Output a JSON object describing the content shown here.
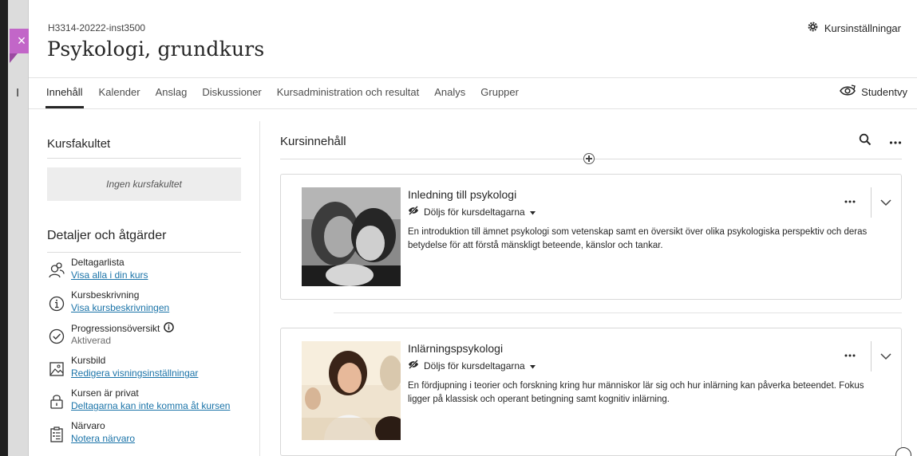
{
  "header": {
    "course_id": "H3314-20222-inst3500",
    "course_title": "Psykologi, grundkurs",
    "settings_label": "Kursinställningar",
    "close_label": "×",
    "backdrop_letter": "I"
  },
  "tabs": [
    {
      "label": "Innehåll",
      "active": true
    },
    {
      "label": "Kalender"
    },
    {
      "label": "Anslag"
    },
    {
      "label": "Diskussioner"
    },
    {
      "label": "Kursadministration och resultat"
    },
    {
      "label": "Analys"
    },
    {
      "label": "Grupper"
    }
  ],
  "studentvy_label": "Studentvy",
  "sidebar": {
    "faculty_title": "Kursfakultet",
    "no_faculty": "Ingen kursfakultet",
    "details_title": "Detaljer och åtgärder",
    "items": [
      {
        "icon": "people-icon",
        "label": "Deltagarlista",
        "link": "Visa alla i din kurs"
      },
      {
        "icon": "info-icon",
        "label": "Kursbeskrivning",
        "link": "Visa kursbeskrivningen"
      },
      {
        "icon": "check-circle-icon",
        "label": "Progressionsöversikt",
        "status": "Aktiverad"
      },
      {
        "icon": "image-icon",
        "label": "Kursbild",
        "link": "Redigera visningsinställningar"
      },
      {
        "icon": "lock-icon",
        "label": "Kursen är privat",
        "link": "Deltagarna kan inte komma åt kursen"
      },
      {
        "icon": "attendance-icon",
        "label": "Närvaro",
        "link": "Notera närvaro"
      }
    ]
  },
  "main": {
    "title": "Kursinnehåll",
    "items": [
      {
        "title": "Inledning till psykologi",
        "visibility": "Döljs för kursdeltagarna",
        "description": "En introduktion till ämnet psykologi som vetenskap samt en översikt över olika psykologiska perspektiv och deras betydelse för att förstå mänskligt beteende, känslor och tankar."
      },
      {
        "title": "Inlärningspsykologi",
        "visibility": "Döljs för kursdeltagarna",
        "description": "En fördjupning i teorier och forskning kring hur människor lär sig och hur inlärning kan påverka beteendet. Fokus ligger på klassisk och operant betingning samt kognitiv inlärning."
      }
    ]
  },
  "colors": {
    "accent": "#c266c8",
    "link": "#1a73a8",
    "text": "#262626"
  }
}
